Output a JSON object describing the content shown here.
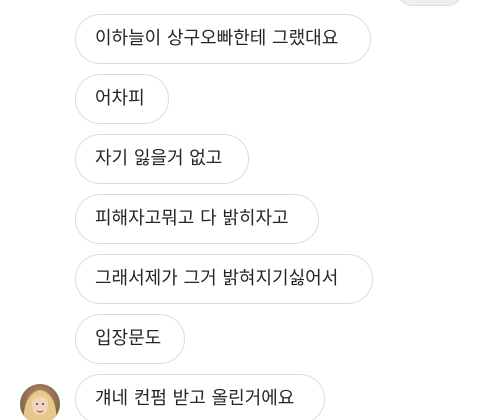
{
  "messages": [
    {
      "text": "이하늘이 상구오빠한테 그랬대요"
    },
    {
      "text": "어차피"
    },
    {
      "text": "자기 잃을거 없고"
    },
    {
      "text": "피해자고뭐고 다 밝히자고"
    },
    {
      "text": "그래서제가 그거 밝혀지기싫어서"
    },
    {
      "text": "입장문도"
    },
    {
      "text": "걔네 컨펌 받고 올린거에요"
    }
  ],
  "colors": {
    "bubble_border": "#dbdbdb",
    "bubble_bg": "#ffffff",
    "text": "#262626"
  }
}
